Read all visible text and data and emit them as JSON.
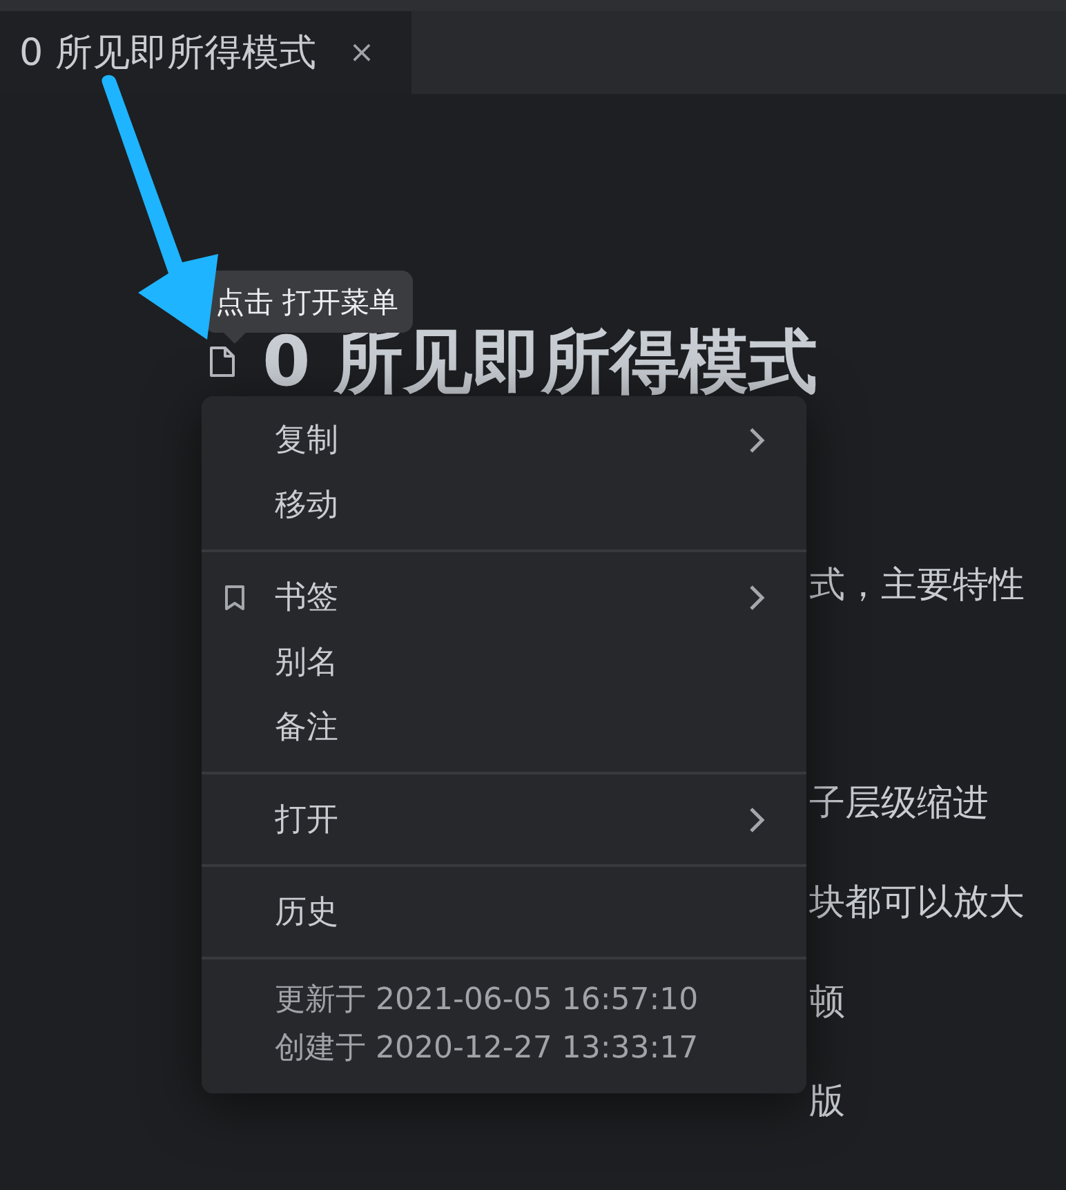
{
  "tabs": [
    {
      "label": "0 所见即所得模式",
      "selected": true,
      "close": "×"
    }
  ],
  "tooltip": "点击 打开菜单",
  "document": {
    "title": "0 所见即所得模式",
    "lines": [
      "式，主要特性",
      "子层级缩进",
      "块都可以放大",
      "顿",
      "版"
    ]
  },
  "menu": {
    "groups": [
      [
        {
          "label": "复制",
          "submenu": true
        },
        {
          "label": "移动",
          "submenu": false
        }
      ],
      [
        {
          "label": "书签",
          "submenu": true,
          "kind": "bookmark"
        },
        {
          "label": "别名",
          "submenu": false
        },
        {
          "label": "备注",
          "submenu": false
        }
      ],
      [
        {
          "label": "打开",
          "submenu": true
        }
      ],
      [
        {
          "label": "历史",
          "submenu": false
        }
      ]
    ],
    "info": [
      "更新于 2021-06-05 16:57:10",
      "创建于 2020-12-27 13:33:17"
    ]
  }
}
